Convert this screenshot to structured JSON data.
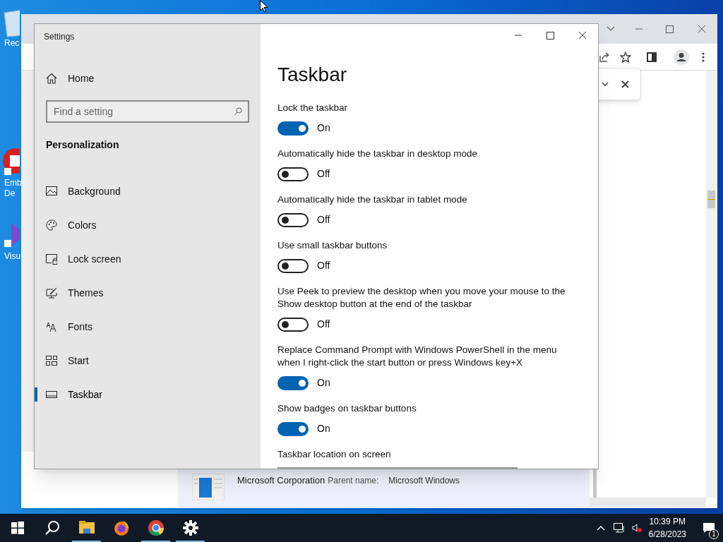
{
  "desktop_icons": [
    {
      "lines": [
        "Rec"
      ],
      "kind": "bin"
    },
    {
      "lines": [
        "Emb",
        "De"
      ],
      "kind": "app-red"
    },
    {
      "lines": [
        "Visu"
      ],
      "kind": "app-purple"
    }
  ],
  "background_window": {
    "details": {
      "publisher": "Microsoft Corporation",
      "parent_label": "Parent name:",
      "parent_value": "Microsoft Windows"
    }
  },
  "settings": {
    "title": "Settings",
    "home": "Home",
    "search": {
      "placeholder": "Find a setting"
    },
    "section": "Personalization",
    "nav": [
      {
        "label": "Background",
        "selected": false
      },
      {
        "label": "Colors",
        "selected": false
      },
      {
        "label": "Lock screen",
        "selected": false
      },
      {
        "label": "Themes",
        "selected": false
      },
      {
        "label": "Fonts",
        "selected": false
      },
      {
        "label": "Start",
        "selected": false
      },
      {
        "label": "Taskbar",
        "selected": true
      }
    ],
    "page_title": "Taskbar",
    "options": [
      {
        "kind": "toggle",
        "label": "Lock the taskbar",
        "on": true,
        "state": "On"
      },
      {
        "kind": "toggle",
        "label": "Automatically hide the taskbar in desktop mode",
        "on": false,
        "state": "Off"
      },
      {
        "kind": "toggle",
        "label": "Automatically hide the taskbar in tablet mode",
        "on": false,
        "state": "Off"
      },
      {
        "kind": "toggle",
        "label": "Use small taskbar buttons",
        "on": false,
        "state": "Off"
      },
      {
        "kind": "toggle",
        "label": "Use Peek to preview the desktop when you move your mouse to the Show desktop button at the end of the taskbar",
        "on": false,
        "state": "Off"
      },
      {
        "kind": "toggle",
        "label": "Replace Command Prompt with Windows PowerShell in the menu when I right-click the start button or press Windows key+X",
        "on": true,
        "state": "On"
      },
      {
        "kind": "toggle",
        "label": "Show badges on taskbar buttons",
        "on": true,
        "state": "On"
      },
      {
        "kind": "dropdown",
        "label": "Taskbar location on screen"
      }
    ]
  },
  "taskbar": {
    "apps": [
      {
        "kind": "start",
        "running": false
      },
      {
        "kind": "search",
        "running": false
      },
      {
        "kind": "explorer",
        "running": true
      },
      {
        "kind": "firefox",
        "running": false
      },
      {
        "kind": "chrome",
        "running": true
      },
      {
        "kind": "settings",
        "running": true
      }
    ],
    "time": "10:39 PM",
    "date": "6/28/2023",
    "notifications": "1"
  }
}
